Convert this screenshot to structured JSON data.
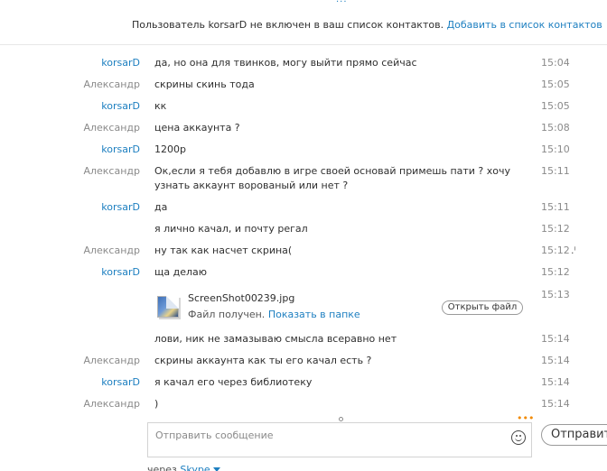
{
  "header": {
    "dots": "...",
    "notice_text": "Пользователь korsarD не включен в ваш список контактов.",
    "notice_link": "Добавить в список контактов"
  },
  "messages": [
    {
      "sender": "korsarD",
      "text": "да, но она для твинков, могу выйти прямо сейчас",
      "time": "15:04"
    },
    {
      "sender": "Александр",
      "text": "скрины скинь тода",
      "time": "15:05"
    },
    {
      "sender": "korsarD",
      "text": "кк",
      "time": "15:05"
    },
    {
      "sender": "Александр",
      "text": "цена аккаунта ?",
      "time": "15:08"
    },
    {
      "sender": "korsarD",
      "text": "1200р",
      "time": "15:10"
    },
    {
      "sender": "Александр",
      "text": "Ок,если я тебя добавлю в игре своей основай примешь пати ? хочу узнать аккаунт ворованый или нет ?",
      "time": "15:11"
    },
    {
      "sender": "korsarD",
      "text": "да",
      "time": "15:11"
    },
    {
      "sender": "",
      "text": "я лично качал, и почту регал",
      "time": "15:12"
    },
    {
      "sender": "Александр",
      "text": "ну так как насчет скрина(",
      "time": "15:12"
    },
    {
      "sender": "korsarD",
      "text": "ща делаю",
      "time": "15:12"
    },
    {
      "sender": "",
      "text": "лови, ник не замазываю смысла всеравно нет",
      "time": "15:14"
    },
    {
      "sender": "Александр",
      "text": "скрины аккаунта как ты его качал есть ?",
      "time": "15:14"
    },
    {
      "sender": "korsarD",
      "text": "я качал его через библиотеку",
      "time": "15:14"
    },
    {
      "sender": "Александр",
      "text": ")",
      "time": "15:14"
    }
  ],
  "edit_mark": ".ⁱ",
  "file_transfer": {
    "filename": "ScreenShot00239.jpg",
    "status": "Файл получен.",
    "folder_link": "Показать в папке",
    "open_button": "Открыть файл",
    "time": "15:13",
    "icon": "image-file-icon"
  },
  "typing_indicator": "•••",
  "compose": {
    "placeholder": "Отправить сообщение",
    "emoticon_icon": "smiley-icon",
    "send_label": "Отправит"
  },
  "footer": {
    "via_text": "через",
    "via_link": "Skype"
  },
  "colors": {
    "link_blue": "#1d7fc0",
    "contact_gray": "#8a8a8a",
    "typing_orange": "#f28a00"
  }
}
